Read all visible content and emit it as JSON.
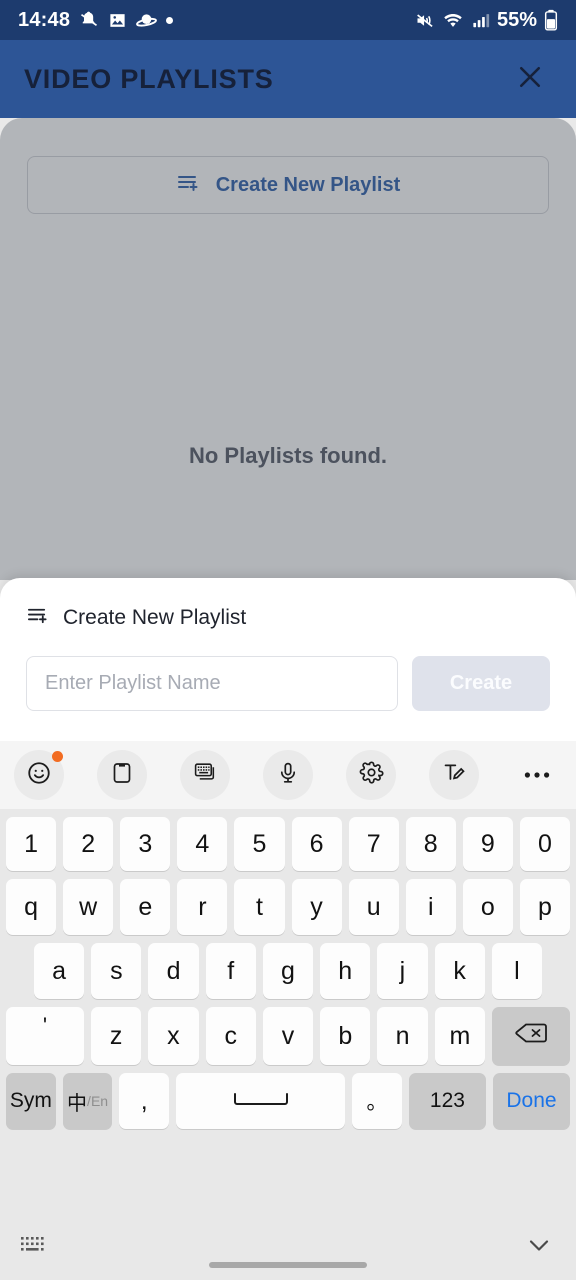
{
  "status_bar": {
    "time": "14:48",
    "left_icons": [
      "muted-bell-icon",
      "image-icon",
      "saturn-icon",
      "dot-icon"
    ],
    "right_icons": [
      "volume-mute-icon",
      "wifi-icon",
      "signal-icon"
    ],
    "battery_percent": "55%",
    "background_color": "#1d3b6e"
  },
  "app_bar": {
    "title": "VIDEO PLAYLISTS",
    "close_icon": "close-icon",
    "background_color": "#2d5596",
    "title_color": "#16213a"
  },
  "content": {
    "create_button": {
      "label": "Create New Playlist",
      "icon": "playlist-add-icon",
      "color": "#2255a4"
    },
    "empty_message": "No Playlists found."
  },
  "sheet": {
    "title": "Create New Playlist",
    "icon": "playlist-add-icon",
    "input": {
      "placeholder": "Enter Playlist Name",
      "value": ""
    },
    "create_label": "Create",
    "create_button_color": "#dfe2eb"
  },
  "keyboard": {
    "toolbar": [
      {
        "name": "emoji-icon",
        "badge": true
      },
      {
        "name": "clipboard-icon",
        "badge": false
      },
      {
        "name": "keyboard-modes-icon",
        "badge": false
      },
      {
        "name": "microphone-icon",
        "badge": false
      },
      {
        "name": "settings-icon",
        "badge": false
      },
      {
        "name": "handwriting-icon",
        "badge": false
      },
      {
        "name": "more-icon",
        "badge": false
      }
    ],
    "rows": {
      "numbers": [
        "1",
        "2",
        "3",
        "4",
        "5",
        "6",
        "7",
        "8",
        "9",
        "0"
      ],
      "top": [
        "q",
        "w",
        "e",
        "r",
        "t",
        "y",
        "u",
        "i",
        "o",
        "p"
      ],
      "home": [
        "a",
        "s",
        "d",
        "f",
        "g",
        "h",
        "j",
        "k",
        "l"
      ],
      "bottom": [
        "'",
        "z",
        "x",
        "c",
        "v",
        "b",
        "n",
        "m"
      ]
    },
    "backspace_icon": "backspace-icon",
    "function_row": {
      "sym": "Sym",
      "lang_cn": "中",
      "lang_en": "En",
      "comma": ",",
      "space_icon": "space-icon",
      "period": "。",
      "numeric": "123",
      "done": "Done"
    },
    "footer": {
      "keyboard_icon": "mini-keyboard-icon",
      "hide_icon": "chevron-down-icon"
    },
    "background_color": "#e8e8e8"
  }
}
